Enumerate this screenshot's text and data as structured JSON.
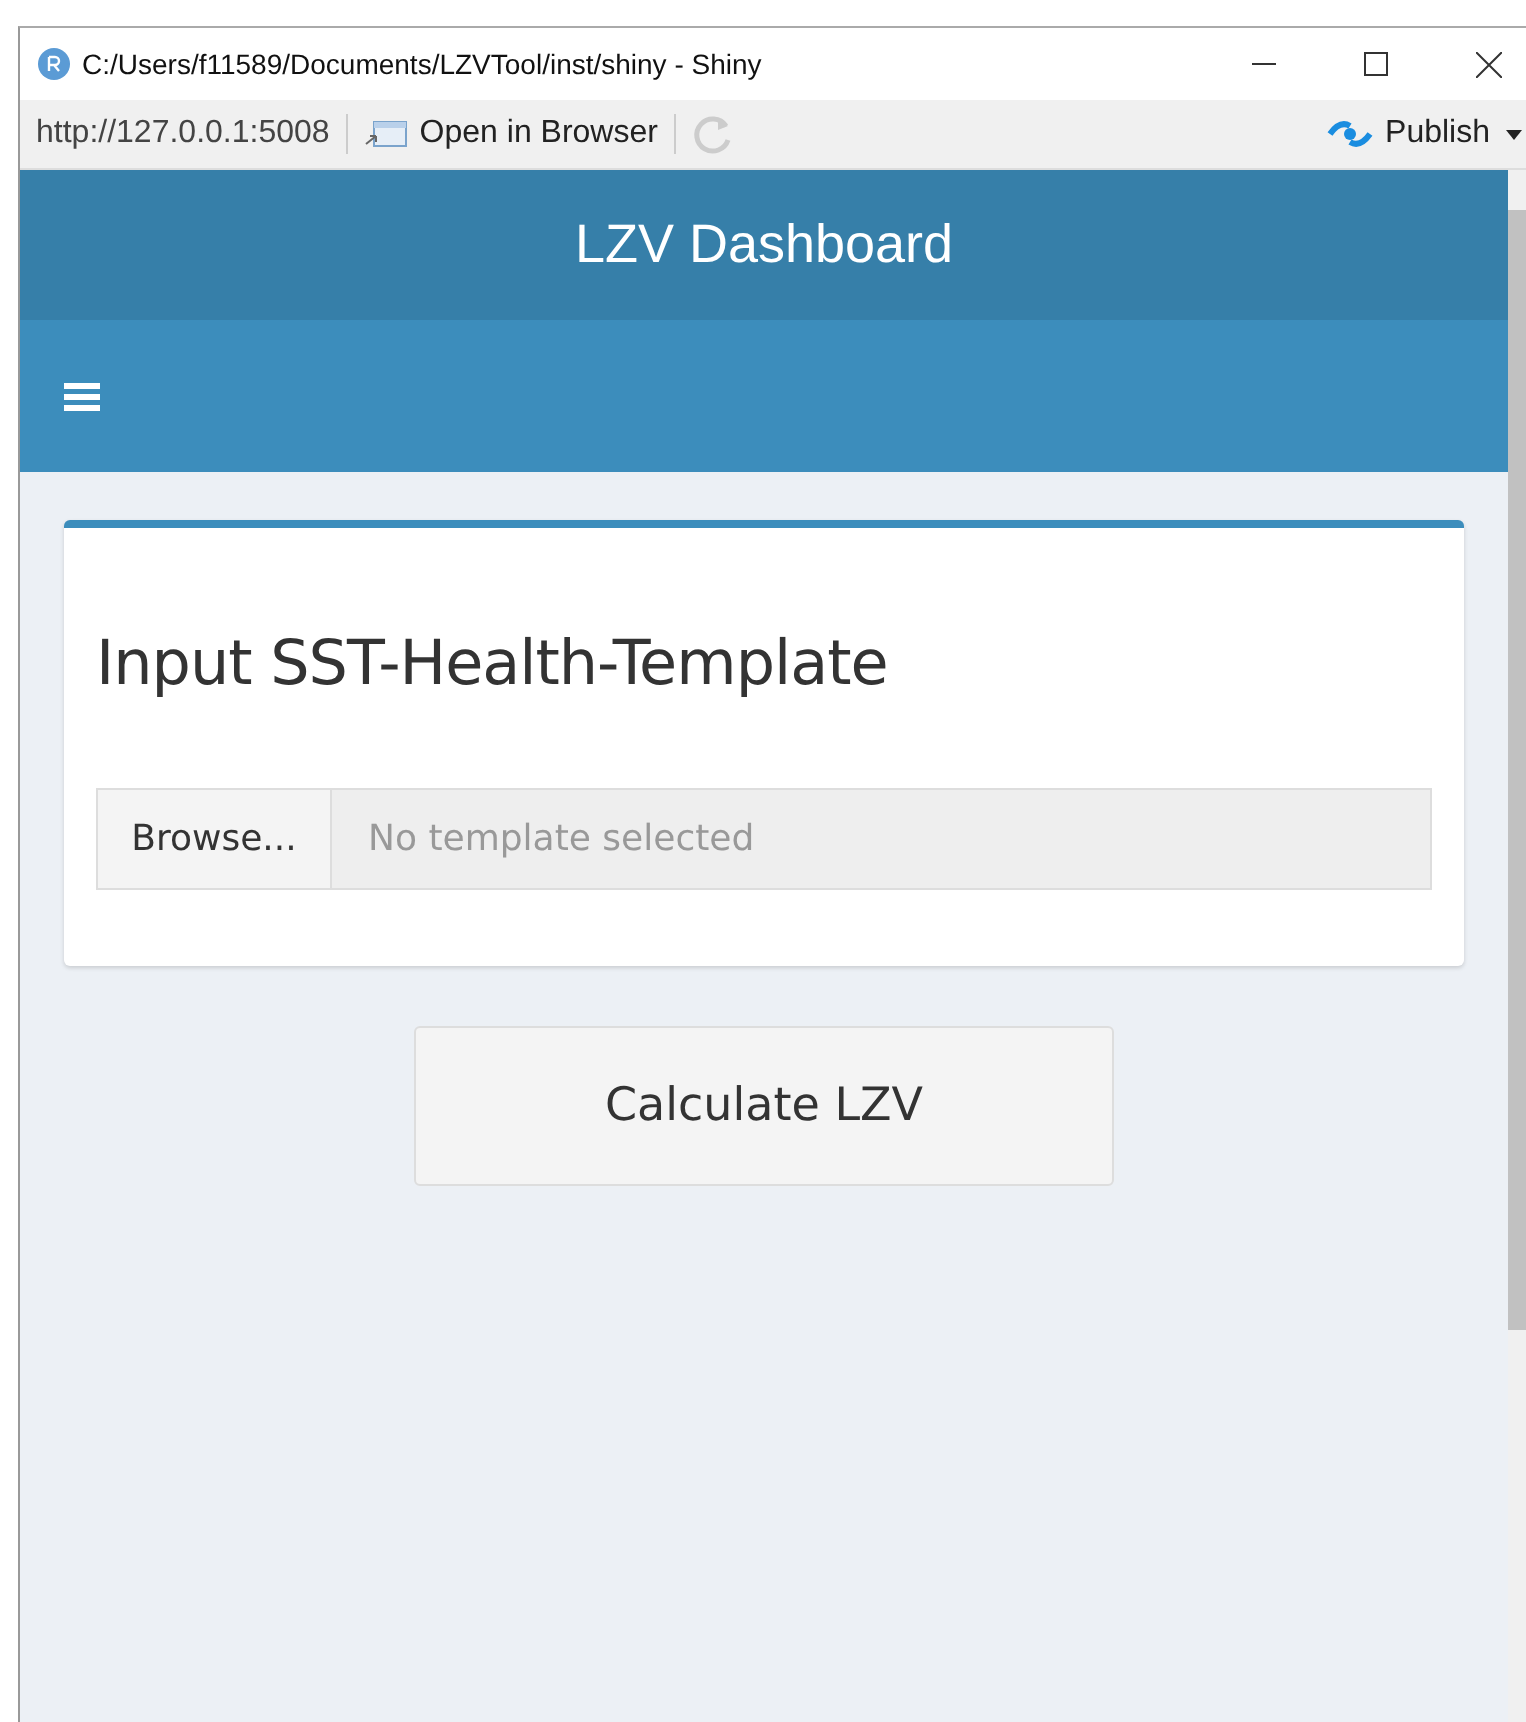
{
  "window": {
    "title": "C:/Users/f11589/Documents/LZVTool/inst/shiny - Shiny"
  },
  "toolbar": {
    "url": "http://127.0.0.1:5008",
    "open_in_browser": "Open in Browser",
    "publish": "Publish"
  },
  "header": {
    "title": "LZV Dashboard"
  },
  "box": {
    "title": "Input SST-Health-Template",
    "browse_button": "Browse...",
    "file_placeholder": "No template selected"
  },
  "action_button": "Calculate LZV"
}
